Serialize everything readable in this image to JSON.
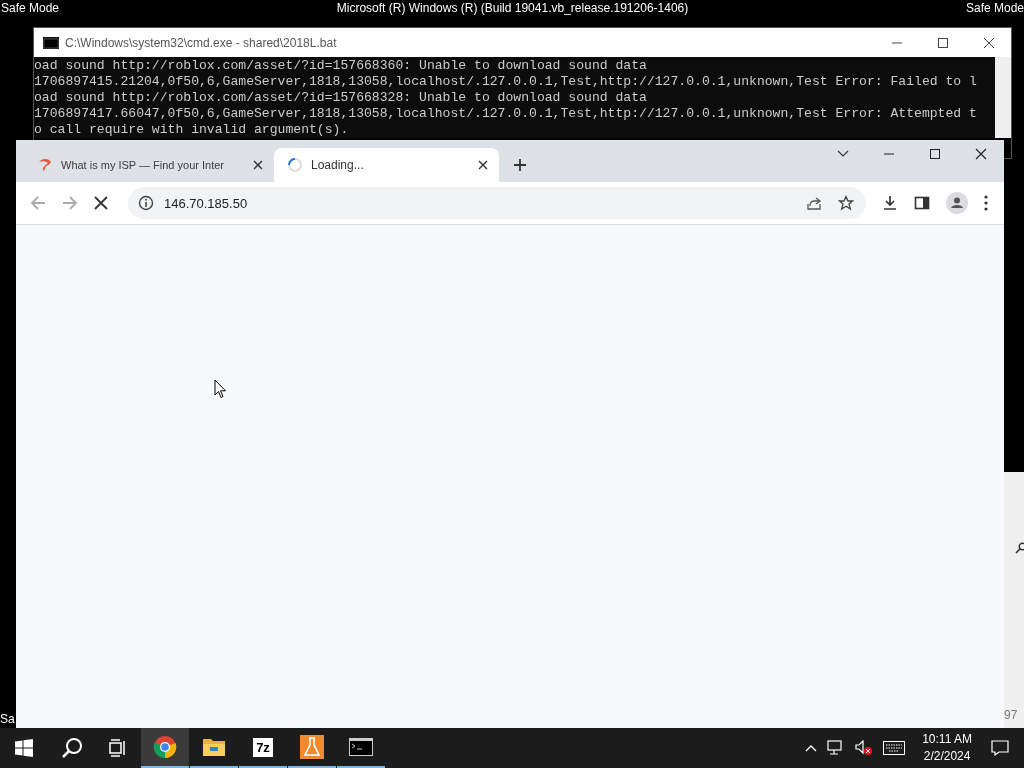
{
  "desktop": {
    "top_left_label": "Safe Mode",
    "top_center_label": "Microsoft (R) Windows (R) (Build 19041.vb_release.191206-1406)",
    "top_right_label": "Safe Mode",
    "bottom_left_label": "Sa",
    "bottom_right_label": "97"
  },
  "console_window": {
    "title": "C:\\Windows\\system32\\cmd.exe - shared\\2018L.bat",
    "lines": [
      "oad sound http://roblox.com/asset/?id=157668360: Unable to download sound data",
      "1706897415.21204,0f50,6,GameServer,1818,13058,localhost/.127.0.0.1,Test,http://127.0.0.1,unknown,Test Error: Failed to l",
      "oad sound http://roblox.com/asset/?id=157668328: Unable to download sound data",
      "1706897417.66047,0f50,6,GameServer,1818,13058,localhost/.127.0.0.1,Test,http://127.0.0.1,unknown,Test Error: Attempted t",
      "o call require with invalid argument(s)."
    ]
  },
  "browser": {
    "tabs": [
      {
        "title": "What is my ISP — Find your Inter",
        "selected": false,
        "loading": false
      },
      {
        "title": "Loading...",
        "selected": true,
        "loading": true
      }
    ],
    "address": "146.70.185.50"
  },
  "taskbar": {
    "apps": [
      {
        "kind": "chrome",
        "selected": true
      },
      {
        "kind": "folder",
        "selected": false
      },
      {
        "kind": "archiver",
        "label": "7z",
        "selected": false
      },
      {
        "kind": "flask",
        "selected": false
      },
      {
        "kind": "console",
        "selected": false
      }
    ],
    "time": "10:11 AM",
    "date": "2/2/2024"
  }
}
